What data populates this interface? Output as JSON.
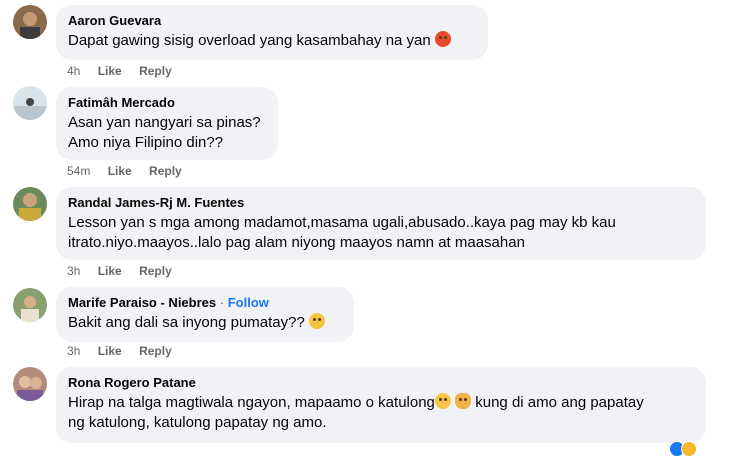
{
  "comments": [
    {
      "name": "Aaron Guevara",
      "follow": "",
      "lines": [
        "Dapat gawing sisig overload yang kasambahay na yan"
      ],
      "emoji": "angry-face-icon",
      "time": "4h",
      "like": "Like",
      "reply": "Reply"
    },
    {
      "name": "Fatimâh Mercado",
      "follow": "",
      "lines": [
        "Asan yan nangyari sa pinas?",
        "Amo niya Filipino din??"
      ],
      "emoji": "",
      "time": "54m",
      "like": "Like",
      "reply": "Reply"
    },
    {
      "name": "Randal James-Rj M. Fuentes",
      "follow": "",
      "lines": [
        "Lesson yan s mga among madamot,masama ugali,abusado..kaya pag may kb kau",
        "itrato.niyo.maayos..lalo pag alam niyong maayos namn at maasahan"
      ],
      "emoji": "",
      "time": "3h",
      "like": "Like",
      "reply": "Reply"
    },
    {
      "name": "Marife Paraiso - Niebres",
      "follow": "Follow",
      "lines": [
        "Bakit ang dali sa inyong pumatay??"
      ],
      "emoji": "crying-face-icon",
      "time": "3h",
      "like": "Like",
      "reply": "Reply"
    },
    {
      "name": "Rona Rogero Patane",
      "follow": "",
      "lines": [
        "Hirap na talga magtiwala ngayon, mapaamo o katulong",
        "kung di amo ang papatay",
        "ng katulong, katulong papatay ng amo."
      ],
      "emoji": "sad-face-icon,woman-facepalming-icon",
      "time": "",
      "like": "",
      "reply": ""
    }
  ],
  "colors": {
    "bubble": "#f0f2f5",
    "meta": "#65676b",
    "link": "#1877f2"
  }
}
